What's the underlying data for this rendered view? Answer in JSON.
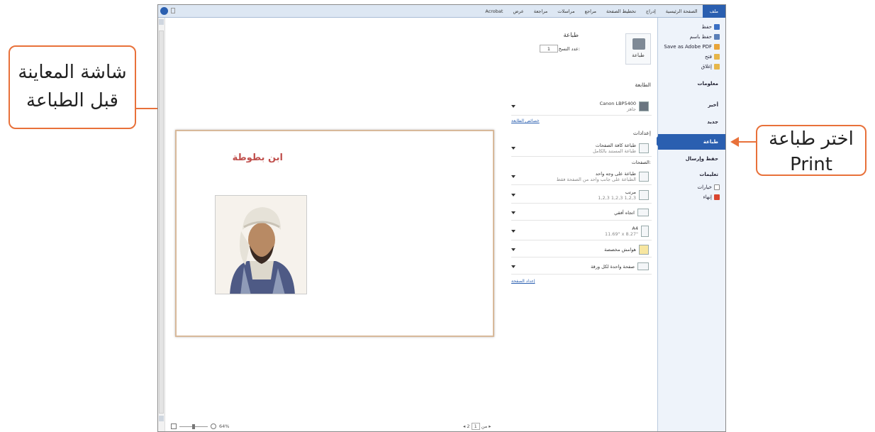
{
  "annotations": {
    "left_callout": [
      "شاشة المعاينة",
      "قبل الطباعة"
    ],
    "right_callout": [
      "اختر طباعة",
      "Print"
    ]
  },
  "ribbon": {
    "tabs": [
      "ملف",
      "الصفحة الرئيسية",
      "إدراج",
      "تخطيط الصفحة",
      "مراجع",
      "مراسلات",
      "مراجعة",
      "عرض",
      "Acrobat"
    ]
  },
  "backstage": {
    "top_items": [
      "حفظ",
      "حفظ باسم",
      "Save as Adobe PDF",
      "فتح",
      "إغلاق"
    ],
    "sections": [
      "معلومات",
      "أخير",
      "جديد",
      "طباعة",
      "حفظ وإرسال",
      "تعليمات"
    ],
    "bottom_items": [
      "خيارات",
      "إنهاء"
    ]
  },
  "print_panel": {
    "title": "طباعة",
    "print_button": "طباعة",
    "copies_label": "عدد النسخ:",
    "copies_value": "1",
    "printer_header": "الطابعة",
    "printer_name": "Canon LBP5400",
    "printer_status": "جاهز",
    "printer_properties_link": "خصائص الطابعة",
    "settings_header": "إعدادات",
    "pages_label": "الصفحات:",
    "options": [
      {
        "main": "طباعة كافة الصفحات",
        "sub": "طباعة المستند بالكامل"
      },
      {
        "main": "طباعة على وجه واحد",
        "sub": "الطباعة على جانب واحد من الصفحة فقط"
      },
      {
        "main": "مرتب",
        "sub": "1,2,3   1,2,3   1,2,3"
      },
      {
        "main": "اتجاه أفقي",
        "sub": ""
      },
      {
        "main": "A4",
        "sub": "11.69\" x 8.27\""
      },
      {
        "main": "هوامش مخصصة",
        "sub": ""
      },
      {
        "main": "صفحة واحدة لكل ورقة",
        "sub": ""
      }
    ],
    "page_setup_link": "إعداد الصفحة"
  },
  "preview": {
    "page_title": "ابن بطوطة",
    "zoom_value": "64%",
    "page_current": "1",
    "page_of": "من",
    "page_total": "2"
  }
}
